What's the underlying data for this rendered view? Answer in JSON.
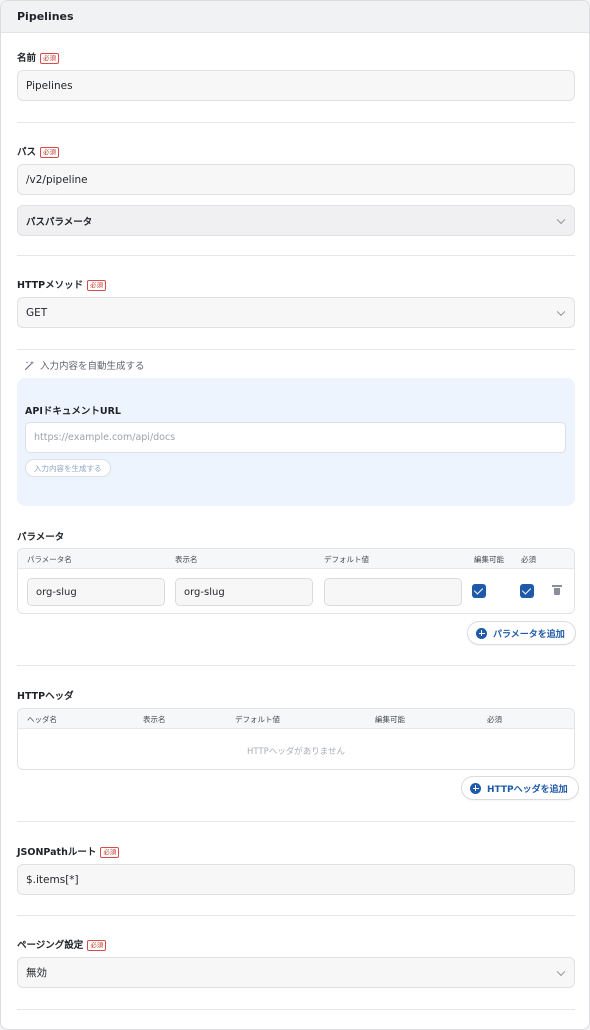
{
  "panel": {
    "title": "Pipelines"
  },
  "required_badge": "必須",
  "name": {
    "label": "名前",
    "value": "Pipelines"
  },
  "path": {
    "label": "パス",
    "value": "/v2/pipeline",
    "params_toggle": "パスパラメータ"
  },
  "method": {
    "label": "HTTPメソッド",
    "value": "GET"
  },
  "autogen": {
    "toggle": "入力内容を自動生成する",
    "api_doc_label": "APIドキュメントURL",
    "api_doc_placeholder": "https://example.com/api/docs",
    "generate_button": "入力内容を生成する"
  },
  "params": {
    "label": "パラメータ",
    "columns": [
      "パラメータ名",
      "表示名",
      "デフォルト値",
      "編集可能",
      "必須"
    ],
    "rows": [
      {
        "name": "org-slug",
        "display_name": "org-slug",
        "default": "",
        "editable": true,
        "required": true
      }
    ],
    "add_button": "パラメータを追加"
  },
  "headers": {
    "label": "HTTPヘッダ",
    "columns": [
      "ヘッダ名",
      "表示名",
      "デフォルト値",
      "編集可能",
      "必須"
    ],
    "empty_text": "HTTPヘッダがありません",
    "add_button": "HTTPヘッダを追加"
  },
  "jsonpath": {
    "label": "JSONPathルート",
    "value": "$.items[*]"
  },
  "paging": {
    "label": "ページング設定",
    "value": "無効"
  },
  "colors": {
    "accent": "#1f5aa8",
    "required": "#c0392b",
    "gen_bg": "#eef4fd"
  },
  "icons": {
    "autogen": "magic-wand-icon",
    "chevron": "chevron-down-icon",
    "delete": "trash-icon",
    "add": "plus-circle-icon"
  }
}
